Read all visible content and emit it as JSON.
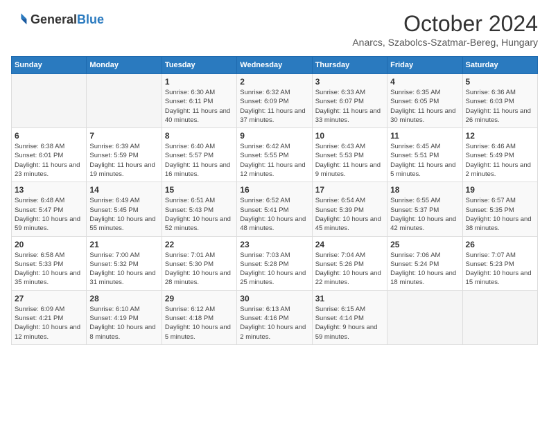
{
  "header": {
    "logo_general": "General",
    "logo_blue": "Blue",
    "month": "October 2024",
    "location": "Anarcs, Szabolcs-Szatmar-Bereg, Hungary"
  },
  "days_of_week": [
    "Sunday",
    "Monday",
    "Tuesday",
    "Wednesday",
    "Thursday",
    "Friday",
    "Saturday"
  ],
  "weeks": [
    [
      {
        "day": "",
        "info": ""
      },
      {
        "day": "",
        "info": ""
      },
      {
        "day": "1",
        "info": "Sunrise: 6:30 AM\nSunset: 6:11 PM\nDaylight: 11 hours and 40 minutes."
      },
      {
        "day": "2",
        "info": "Sunrise: 6:32 AM\nSunset: 6:09 PM\nDaylight: 11 hours and 37 minutes."
      },
      {
        "day": "3",
        "info": "Sunrise: 6:33 AM\nSunset: 6:07 PM\nDaylight: 11 hours and 33 minutes."
      },
      {
        "day": "4",
        "info": "Sunrise: 6:35 AM\nSunset: 6:05 PM\nDaylight: 11 hours and 30 minutes."
      },
      {
        "day": "5",
        "info": "Sunrise: 6:36 AM\nSunset: 6:03 PM\nDaylight: 11 hours and 26 minutes."
      }
    ],
    [
      {
        "day": "6",
        "info": "Sunrise: 6:38 AM\nSunset: 6:01 PM\nDaylight: 11 hours and 23 minutes."
      },
      {
        "day": "7",
        "info": "Sunrise: 6:39 AM\nSunset: 5:59 PM\nDaylight: 11 hours and 19 minutes."
      },
      {
        "day": "8",
        "info": "Sunrise: 6:40 AM\nSunset: 5:57 PM\nDaylight: 11 hours and 16 minutes."
      },
      {
        "day": "9",
        "info": "Sunrise: 6:42 AM\nSunset: 5:55 PM\nDaylight: 11 hours and 12 minutes."
      },
      {
        "day": "10",
        "info": "Sunrise: 6:43 AM\nSunset: 5:53 PM\nDaylight: 11 hours and 9 minutes."
      },
      {
        "day": "11",
        "info": "Sunrise: 6:45 AM\nSunset: 5:51 PM\nDaylight: 11 hours and 5 minutes."
      },
      {
        "day": "12",
        "info": "Sunrise: 6:46 AM\nSunset: 5:49 PM\nDaylight: 11 hours and 2 minutes."
      }
    ],
    [
      {
        "day": "13",
        "info": "Sunrise: 6:48 AM\nSunset: 5:47 PM\nDaylight: 10 hours and 59 minutes."
      },
      {
        "day": "14",
        "info": "Sunrise: 6:49 AM\nSunset: 5:45 PM\nDaylight: 10 hours and 55 minutes."
      },
      {
        "day": "15",
        "info": "Sunrise: 6:51 AM\nSunset: 5:43 PM\nDaylight: 10 hours and 52 minutes."
      },
      {
        "day": "16",
        "info": "Sunrise: 6:52 AM\nSunset: 5:41 PM\nDaylight: 10 hours and 48 minutes."
      },
      {
        "day": "17",
        "info": "Sunrise: 6:54 AM\nSunset: 5:39 PM\nDaylight: 10 hours and 45 minutes."
      },
      {
        "day": "18",
        "info": "Sunrise: 6:55 AM\nSunset: 5:37 PM\nDaylight: 10 hours and 42 minutes."
      },
      {
        "day": "19",
        "info": "Sunrise: 6:57 AM\nSunset: 5:35 PM\nDaylight: 10 hours and 38 minutes."
      }
    ],
    [
      {
        "day": "20",
        "info": "Sunrise: 6:58 AM\nSunset: 5:33 PM\nDaylight: 10 hours and 35 minutes."
      },
      {
        "day": "21",
        "info": "Sunrise: 7:00 AM\nSunset: 5:32 PM\nDaylight: 10 hours and 31 minutes."
      },
      {
        "day": "22",
        "info": "Sunrise: 7:01 AM\nSunset: 5:30 PM\nDaylight: 10 hours and 28 minutes."
      },
      {
        "day": "23",
        "info": "Sunrise: 7:03 AM\nSunset: 5:28 PM\nDaylight: 10 hours and 25 minutes."
      },
      {
        "day": "24",
        "info": "Sunrise: 7:04 AM\nSunset: 5:26 PM\nDaylight: 10 hours and 22 minutes."
      },
      {
        "day": "25",
        "info": "Sunrise: 7:06 AM\nSunset: 5:24 PM\nDaylight: 10 hours and 18 minutes."
      },
      {
        "day": "26",
        "info": "Sunrise: 7:07 AM\nSunset: 5:23 PM\nDaylight: 10 hours and 15 minutes."
      }
    ],
    [
      {
        "day": "27",
        "info": "Sunrise: 6:09 AM\nSunset: 4:21 PM\nDaylight: 10 hours and 12 minutes."
      },
      {
        "day": "28",
        "info": "Sunrise: 6:10 AM\nSunset: 4:19 PM\nDaylight: 10 hours and 8 minutes."
      },
      {
        "day": "29",
        "info": "Sunrise: 6:12 AM\nSunset: 4:18 PM\nDaylight: 10 hours and 5 minutes."
      },
      {
        "day": "30",
        "info": "Sunrise: 6:13 AM\nSunset: 4:16 PM\nDaylight: 10 hours and 2 minutes."
      },
      {
        "day": "31",
        "info": "Sunrise: 6:15 AM\nSunset: 4:14 PM\nDaylight: 9 hours and 59 minutes."
      },
      {
        "day": "",
        "info": ""
      },
      {
        "day": "",
        "info": ""
      }
    ]
  ]
}
